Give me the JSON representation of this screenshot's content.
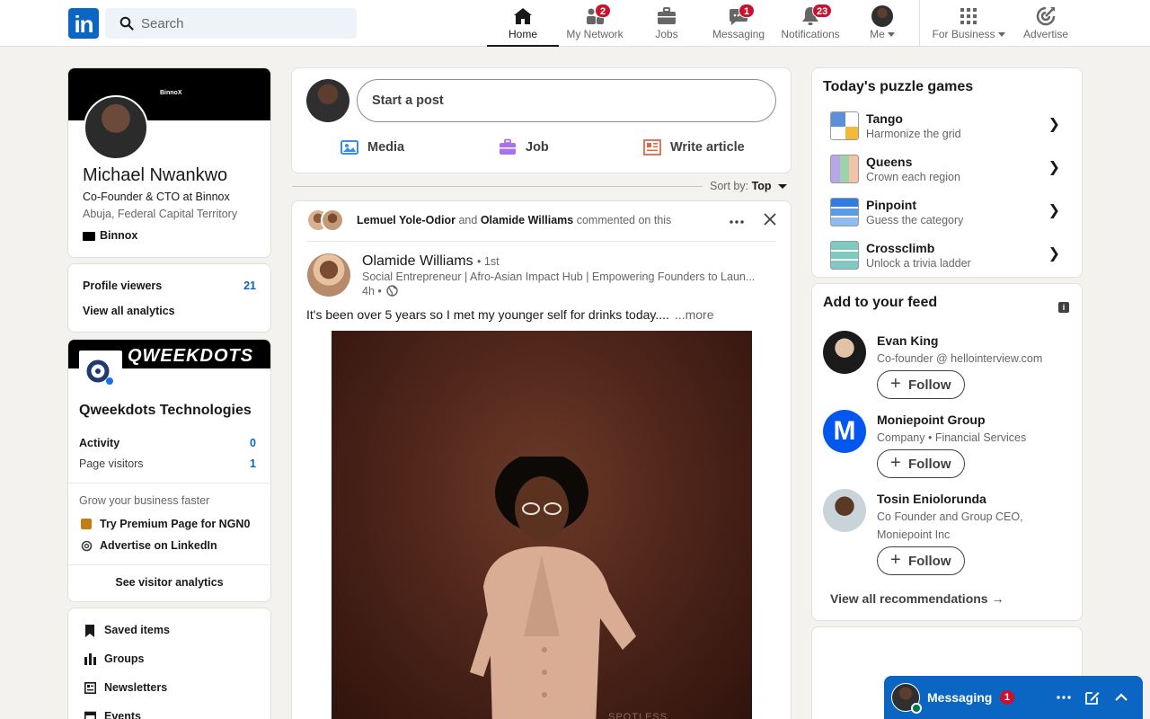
{
  "nav": {
    "logo": "in",
    "search_placeholder": "Search",
    "items": [
      {
        "label": "Home"
      },
      {
        "label": "My Network",
        "badge": "2"
      },
      {
        "label": "Jobs"
      },
      {
        "label": "Messaging",
        "badge": "1"
      },
      {
        "label": "Notifications",
        "badge": "23"
      },
      {
        "label": "Me"
      },
      {
        "label": "For Business"
      },
      {
        "label": "Advertise"
      }
    ]
  },
  "profile": {
    "cover_text": "BinnoX",
    "name": "Michael Nwankwo",
    "title": "Co-Founder & CTO at Binnox",
    "location": "Abuja, Federal Capital Territory",
    "company": "Binnox",
    "viewers_label": "Profile viewers",
    "viewers_count": "21",
    "analytics_link": "View all analytics"
  },
  "page_card": {
    "cover_text": "QWEEKDOTS",
    "name": "Qweekdots Technologies",
    "activity_label": "Activity",
    "activity_value": "0",
    "visitors_label": "Page visitors",
    "visitors_value": "1",
    "grow_text": "Grow your business faster",
    "premium_link": "Try Premium Page for NGN0",
    "advertise_link": "Advertise on LinkedIn",
    "visitor_analytics": "See visitor analytics"
  },
  "shortcuts": [
    {
      "label": "Saved items"
    },
    {
      "label": "Groups"
    },
    {
      "label": "Newsletters"
    },
    {
      "label": "Events"
    }
  ],
  "composer": {
    "start_post": "Start a post",
    "media": "Media",
    "job": "Job",
    "article": "Write article"
  },
  "sort": {
    "label": "Sort by:",
    "value": "Top"
  },
  "post": {
    "context_a": "Lemuel Yole-Odior",
    "context_and": "and",
    "context_b": "Olamide Williams",
    "context_suffix": "commented on this",
    "author": "Olamide Williams",
    "degree": "• 1st",
    "headline": "Social Entrepreneur | Afro-Asian Impact Hub | Empowering Founders to Laun...",
    "time": "4h •",
    "text": "It's been over 5 years so I met my younger self for drinks today....",
    "more": "...more",
    "image_caption": "SPOTLESS"
  },
  "puzzles": {
    "title": "Today's puzzle games",
    "games": [
      {
        "name": "Tango",
        "sub": "Harmonize the grid"
      },
      {
        "name": "Queens",
        "sub": "Crown each region"
      },
      {
        "name": "Pinpoint",
        "sub": "Guess the category"
      },
      {
        "name": "Crossclimb",
        "sub": "Unlock a trivia ladder"
      }
    ]
  },
  "feed_recs": {
    "title": "Add to your feed",
    "people": [
      {
        "name": "Evan King",
        "sub": "Co-founder @ hellointerview.com"
      },
      {
        "name": "Moniepoint Group",
        "sub": "Company • Financial Services"
      },
      {
        "name": "Tosin Eniolorunda",
        "sub": "Co Founder and Group CEO, Moniepoint Inc"
      }
    ],
    "follow_label": "Follow",
    "view_all": "View all recommendations →"
  },
  "messaging": {
    "label": "Messaging",
    "badge": "1"
  },
  "colors": {
    "brand": "#0a66c2",
    "badge": "#cb112d",
    "background": "#f4f2ee"
  }
}
